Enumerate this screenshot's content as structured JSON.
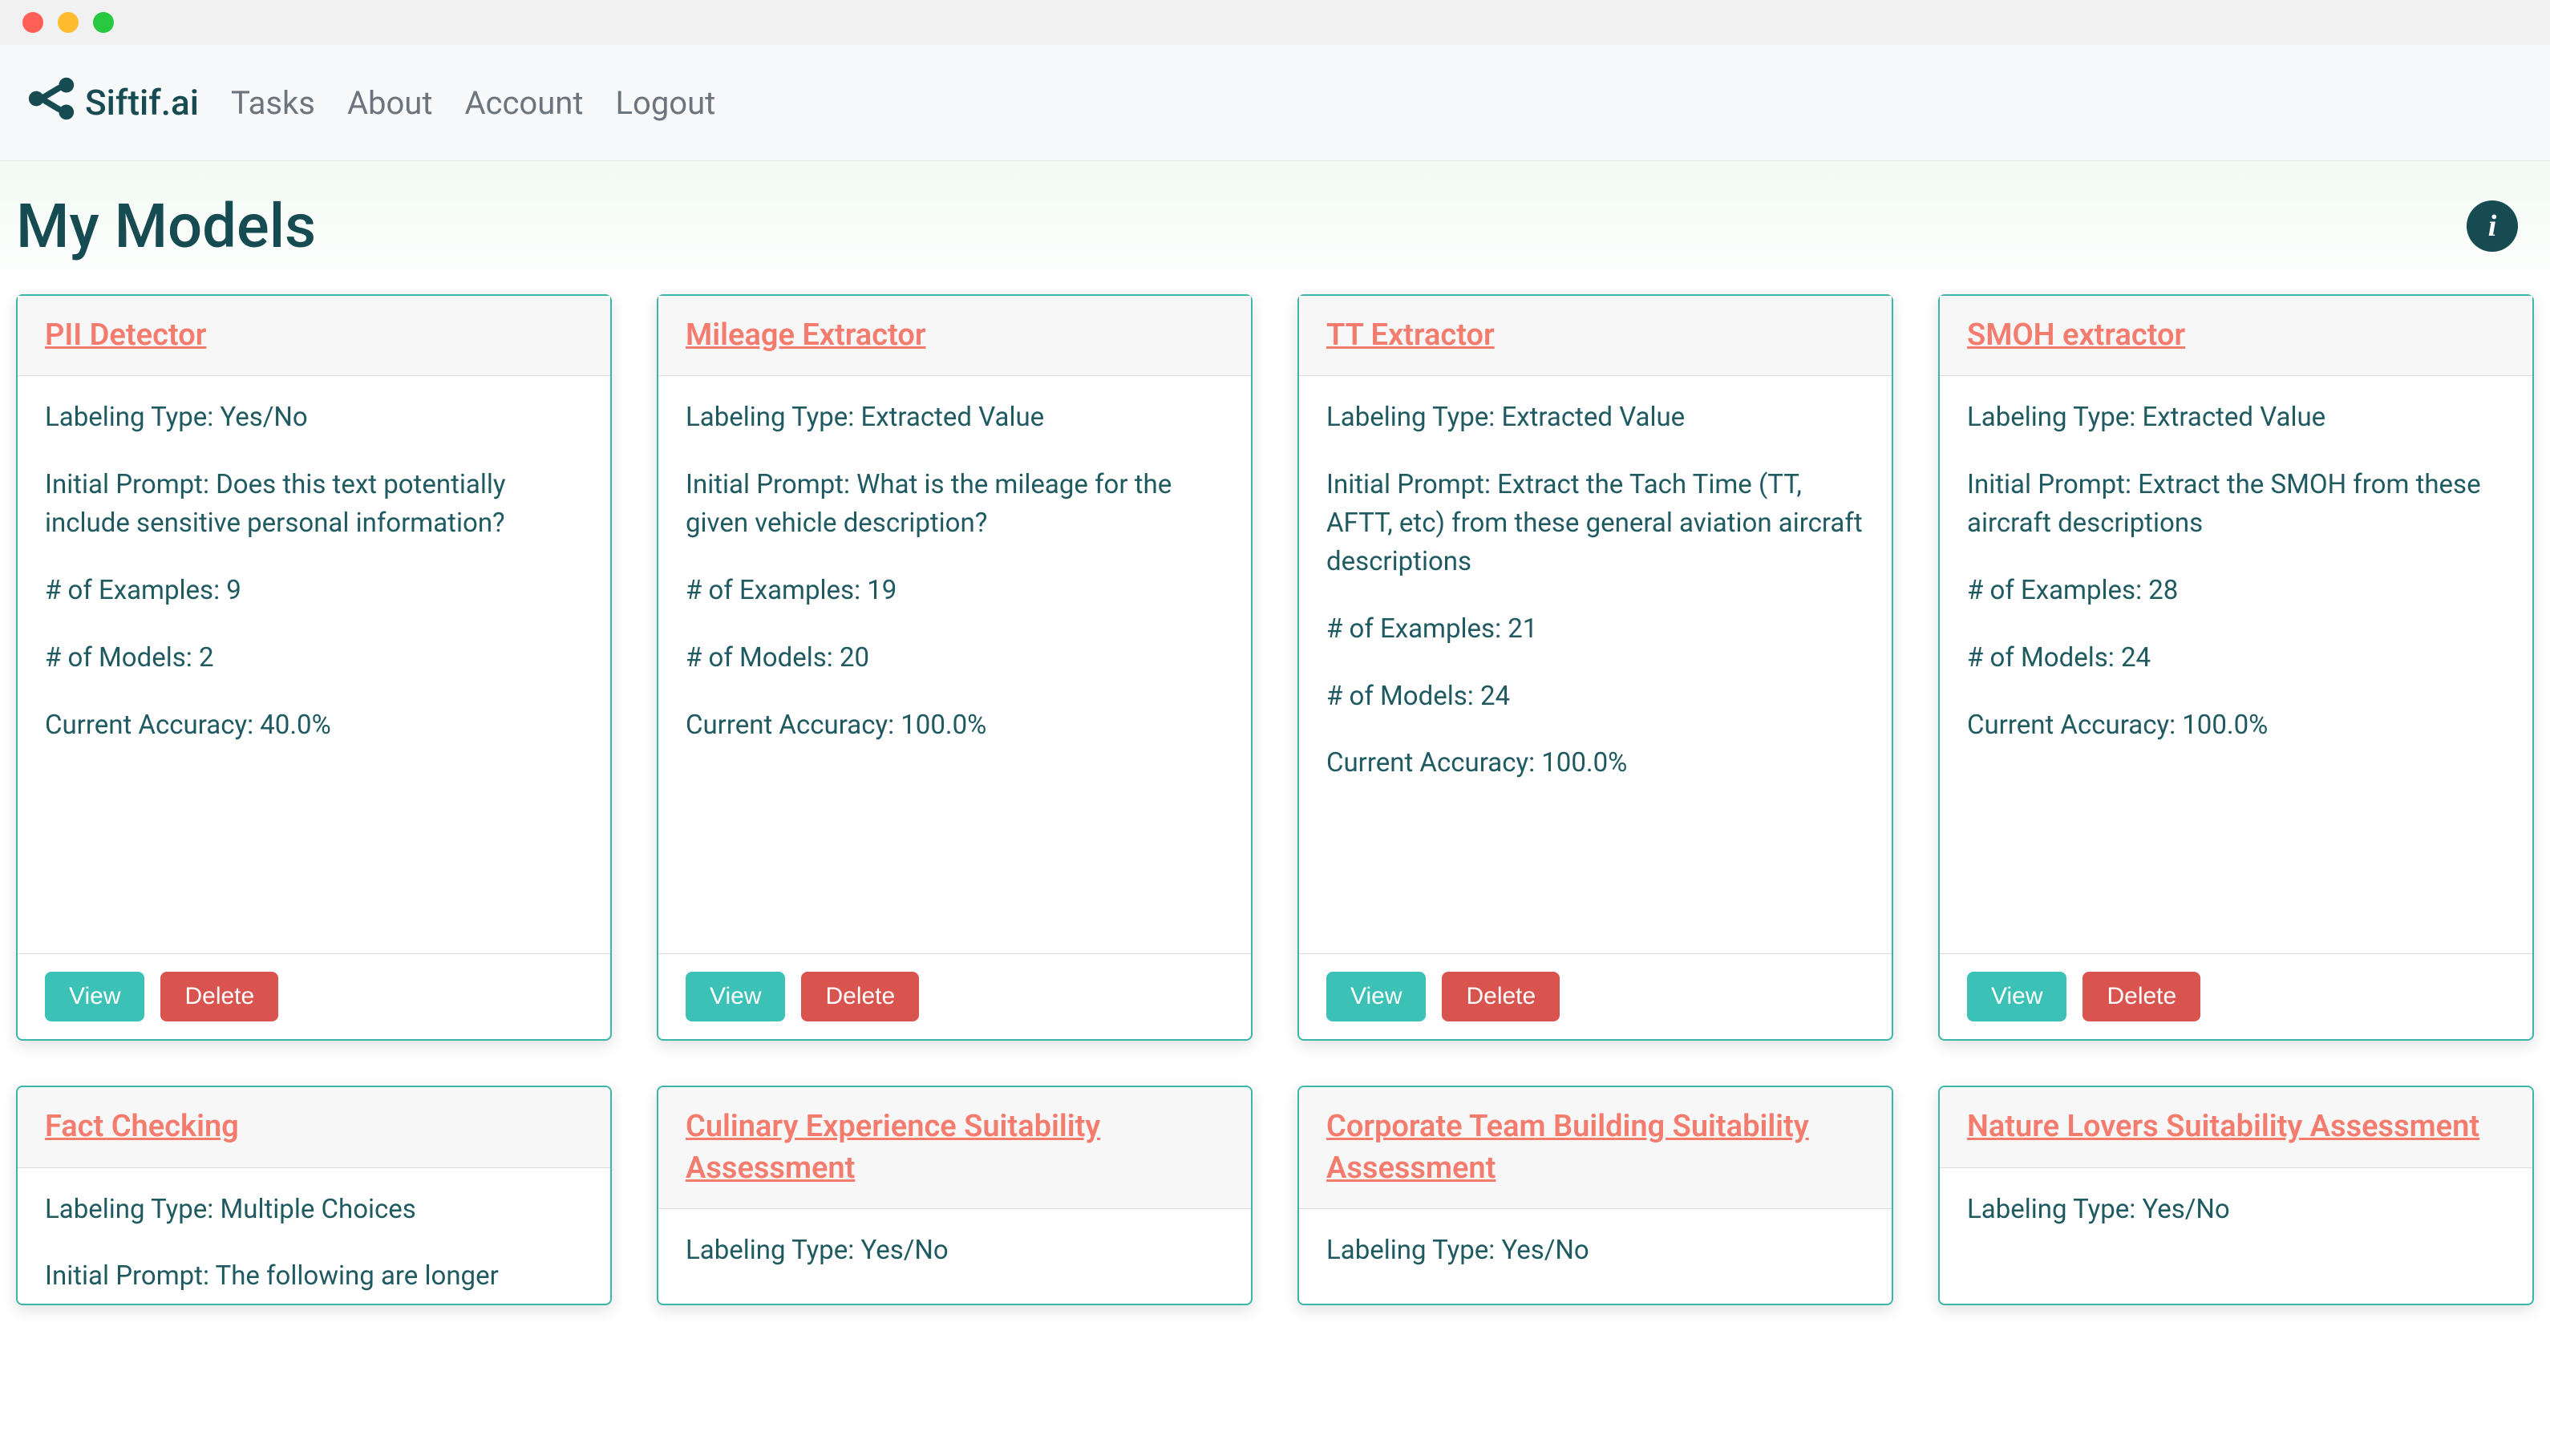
{
  "nav": {
    "brand": "Siftif.ai",
    "links": [
      "Tasks",
      "About",
      "Account",
      "Logout"
    ]
  },
  "page": {
    "title": "My Models"
  },
  "labels": {
    "view": "View",
    "delete": "Delete"
  },
  "colors": {
    "accent_teal": "#3bb6a8",
    "link_salmon": "#f47c6f",
    "danger_red": "#d9534f",
    "brand_dark": "#174b52"
  },
  "models": [
    {
      "title": "PII Detector",
      "labeling": "Labeling Type: Yes/No",
      "prompt": "Initial Prompt: Does this text potentially include sensitive personal information?",
      "examples": "# of Examples: 9",
      "nmodels": "# of Models: 2",
      "accuracy": "Current Accuracy: 40.0%"
    },
    {
      "title": "Mileage Extractor",
      "labeling": "Labeling Type: Extracted Value",
      "prompt": "Initial Prompt: What is the mileage for the given vehicle description?",
      "examples": "# of Examples: 19",
      "nmodels": "# of Models: 20",
      "accuracy": "Current Accuracy: 100.0%"
    },
    {
      "title": "TT Extractor",
      "labeling": "Labeling Type: Extracted Value",
      "prompt": "Initial Prompt: Extract the Tach Time (TT, AFTT, etc) from these general aviation aircraft descriptions",
      "examples": "# of Examples: 21",
      "nmodels": "# of Models: 24",
      "accuracy": "Current Accuracy: 100.0%"
    },
    {
      "title": "SMOH extractor",
      "labeling": "Labeling Type: Extracted Value",
      "prompt": "Initial Prompt: Extract the SMOH from these aircraft descriptions",
      "examples": "# of Examples: 28",
      "nmodels": "# of Models: 24",
      "accuracy": "Current Accuracy: 100.0%"
    },
    {
      "title": "Fact Checking",
      "labeling": "Labeling Type: Multiple Choices",
      "prompt": "Initial Prompt: The following are longer"
    },
    {
      "title": "Culinary Experience Suitability Assessment",
      "labeling": "Labeling Type: Yes/No"
    },
    {
      "title": "Corporate Team Building Suitability Assessment",
      "labeling": "Labeling Type: Yes/No"
    },
    {
      "title": "Nature Lovers Suitability Assessment",
      "labeling": "Labeling Type: Yes/No"
    }
  ]
}
